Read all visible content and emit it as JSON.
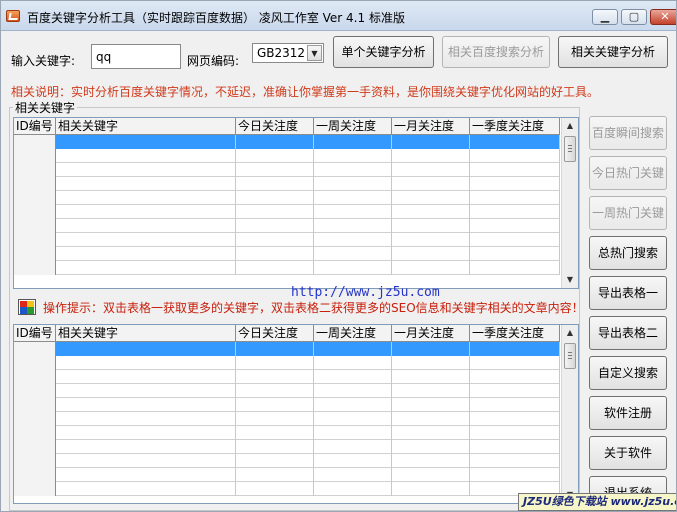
{
  "window": {
    "title": "百度关键字分析工具（实时跟踪百度数据） 凌风工作室  Ver 4.1 标准版",
    "min_glyph": "▁",
    "max_glyph": "▢",
    "close_glyph": "✕"
  },
  "search": {
    "keyword_label": "输入关键字:",
    "keyword_value": "qq",
    "encoding_label": "网页编码:",
    "encoding_value": "GB2312",
    "single_analysis": "单个关键字分析",
    "related_baidu_analysis": "相关百度搜索分析",
    "related_analysis": "相关关键字分析"
  },
  "note": "相关说明：实时分析百度关键字情况，不延迟，准确让你掌握第一手资料，是你围绕关键字优化网站的好工具。",
  "group_title": "相关关键字",
  "columns": [
    "ID编号",
    "相关关键字",
    "今日关注度",
    "一周关注度",
    "一月关注度",
    "一季度关注度"
  ],
  "url": "http://www.jz5u.com",
  "tip": "操作提示：双击表格一获取更多的关键字，双击表格二获得更多的SEO信息和关键字相关的文章内容！",
  "side_buttons": [
    {
      "label": "百度瞬间搜索",
      "disabled": true
    },
    {
      "label": "今日热门关键",
      "disabled": true
    },
    {
      "label": "一周热门关键",
      "disabled": true
    },
    {
      "label": "总热门搜索",
      "disabled": false
    },
    {
      "label": "导出表格一",
      "disabled": false
    },
    {
      "label": "导出表格二",
      "disabled": false
    },
    {
      "label": "自定义搜索",
      "disabled": false
    },
    {
      "label": "软件注册",
      "disabled": false
    },
    {
      "label": "关于软件",
      "disabled": false
    },
    {
      "label": "退出系统",
      "disabled": false
    }
  ],
  "watermark": "JZ5U绿色下载站 www.jz5u.com",
  "icons": {
    "app": "app-logo-icon",
    "tip": "color-squares-icon",
    "scroll_up": "▲",
    "scroll_down": "▼",
    "dropdown": "▼"
  },
  "colors": {
    "note_text": "#d03a1b",
    "tip_text": "#c8200c",
    "url_text": "#2535c8",
    "selection": "#3399ff"
  }
}
